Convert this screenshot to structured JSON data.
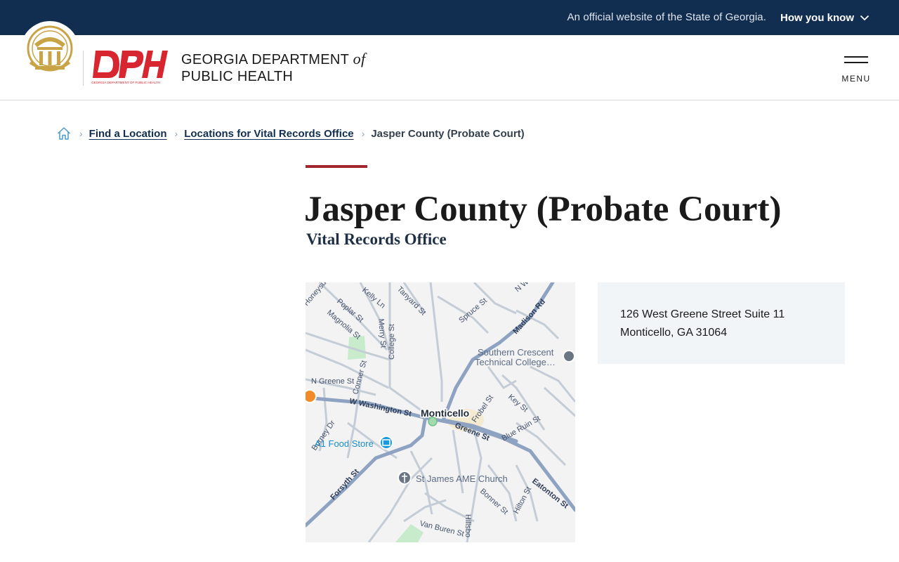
{
  "gov_banner": {
    "official_text": "An official website of the State of Georgia.",
    "how_you_know": "How you know"
  },
  "header": {
    "logo_text": "DPH",
    "logo_subtext": "GEORGIA DEPARTMENT OF PUBLIC HEALTH",
    "dept_line1": "GEORGIA DEPARTMENT",
    "dept_of": "of",
    "dept_line2": "PUBLIC HEALTH",
    "menu_label": "MENU"
  },
  "breadcrumb": {
    "items": [
      {
        "label": "Find a Location"
      },
      {
        "label": "Locations for Vital Records Office"
      }
    ],
    "current": "Jasper County (Probate Court)"
  },
  "page": {
    "title": "Jasper County (Probate Court)",
    "subtitle": "Vital Records Office"
  },
  "address": {
    "line1": "126 West Greene Street Suite 11",
    "line2": "Monticello, GA 31064"
  },
  "map": {
    "streets": [
      "Honeysuckle",
      "Kelly Ln",
      "Tanyard St",
      "N Wa",
      "Poplar St",
      "Magnolia St",
      "Merry St",
      "College St",
      "Spruce St",
      "Madison Rd",
      "N Greene St",
      "Conner St",
      "W Washington St",
      "Frobel St",
      "Key St",
      "Burney Dr",
      "Greene St",
      "Blue Ruin St",
      "Forsyth St",
      "Eatonton St",
      "Bonner St",
      "Hilton St",
      "Van Buren St",
      "Hillsbo"
    ],
    "town": "Monticello",
    "pois": {
      "college": "Southern Crescent",
      "college2": "Technical College…",
      "food_store": "A1 Food Store",
      "church": "St James AME Church"
    },
    "colors": {
      "major_road": "#8ea3c1",
      "minor_road": "#c4ccd6",
      "park": "#c8ebcc",
      "poi_blue": "#1a9bd7",
      "poi_orange": "#f28a28",
      "poi_gray": "#6b7684"
    }
  },
  "colors": {
    "banner_bg": "#112e51",
    "accent_red": "#a3262f",
    "card_bg": "#f2f5f8"
  }
}
